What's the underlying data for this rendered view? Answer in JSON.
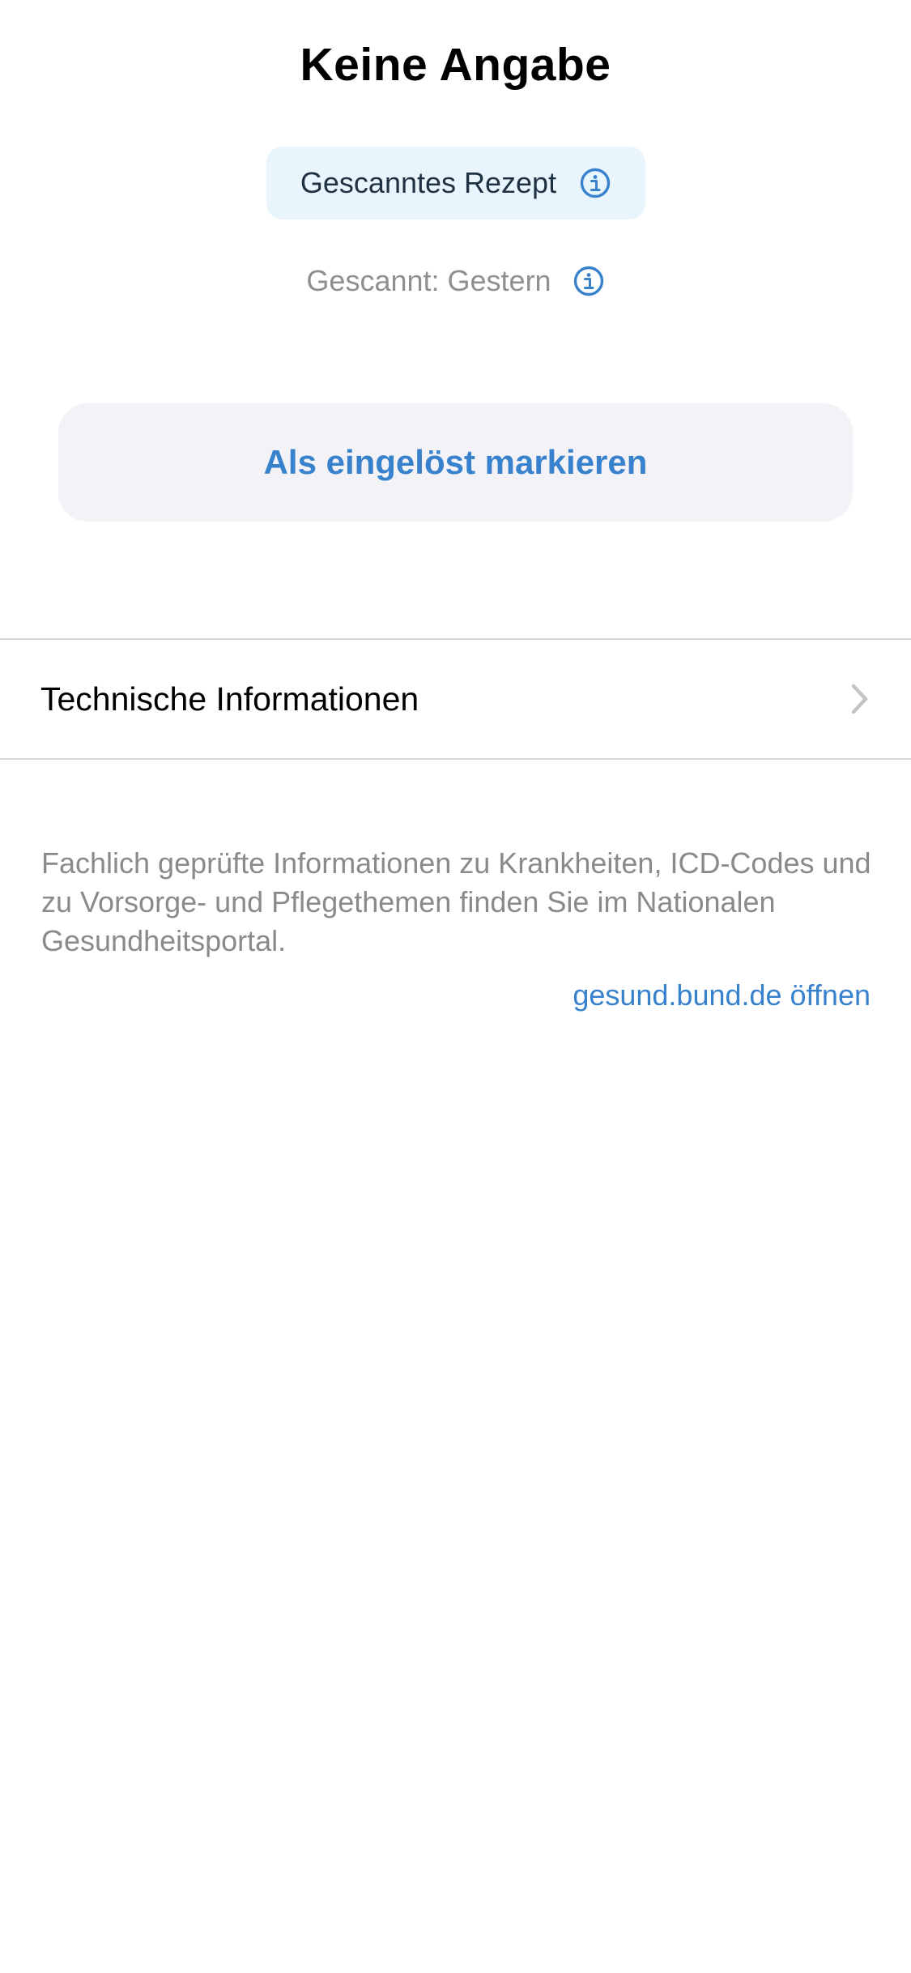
{
  "header": {
    "title": "Keine Angabe"
  },
  "badge": {
    "label": "Gescanntes Rezept",
    "icon": "info-circle-icon",
    "background_color": "#e8f5fd"
  },
  "scan_info": {
    "label": "Gescannt: Gestern",
    "icon": "info-circle-icon"
  },
  "actions": {
    "mark_redeemed_label": "Als eingelöst markieren"
  },
  "list": {
    "items": [
      {
        "label": "Technische Informationen",
        "icon": "chevron-right-icon"
      }
    ]
  },
  "footer": {
    "text": "Fachlich geprüfte Informationen zu Krankheiten, ICD-Codes und zu Vorsorge- und Pflegethemen finden Sie im Nationalen Gesundheitsportal.",
    "link_label": "gesund.bund.de öffnen"
  },
  "colors": {
    "accent": "#3882cd",
    "secondary_text": "#8e8e93",
    "button_background": "#f2f2f7",
    "divider": "#d8d8dc"
  }
}
